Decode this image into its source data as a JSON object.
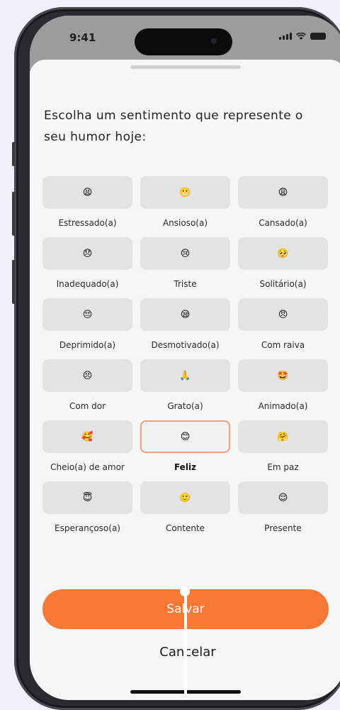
{
  "status_bar": {
    "time": "9:41"
  },
  "prompt": "Escolha um sentimento que represente o seu humor hoje:",
  "moods": [
    {
      "label": "Estressado(a)",
      "emoji": "😫",
      "selected": false
    },
    {
      "label": "Ansioso(a)",
      "emoji": "😬",
      "selected": false
    },
    {
      "label": "Cansado(a)",
      "emoji": "😩",
      "selected": false
    },
    {
      "label": "Inadequado(a)",
      "emoji": "😞",
      "selected": false
    },
    {
      "label": "Triste",
      "emoji": "😢",
      "selected": false
    },
    {
      "label": "Solitário(a)",
      "emoji": "🥺",
      "selected": false
    },
    {
      "label": "Deprimido(a)",
      "emoji": "😔",
      "selected": false
    },
    {
      "label": "Desmotivado(a)",
      "emoji": "😪",
      "selected": false
    },
    {
      "label": "Com raiva",
      "emoji": "😠",
      "selected": false
    },
    {
      "label": "Com dor",
      "emoji": "😣",
      "selected": false
    },
    {
      "label": "Grato(a)",
      "emoji": "🙏",
      "selected": false
    },
    {
      "label": "Animado(a)",
      "emoji": "🤩",
      "selected": false
    },
    {
      "label": "Cheio(a) de amor",
      "emoji": "🥰",
      "selected": false
    },
    {
      "label": "Feliz",
      "emoji": "😊",
      "selected": true
    },
    {
      "label": "Em paz",
      "emoji": "🤗",
      "selected": false
    },
    {
      "label": "Esperançoso(a)",
      "emoji": "😇",
      "selected": false
    },
    {
      "label": "Contente",
      "emoji": "🙂",
      "selected": false
    },
    {
      "label": "Presente",
      "emoji": "😌",
      "selected": false
    }
  ],
  "actions": {
    "save_label": "Salvar",
    "cancel_label": "Cancelar"
  },
  "colors": {
    "accent": "#f77735",
    "selected_border": "#f0a07a",
    "tile_bg": "#e3e3e3"
  }
}
